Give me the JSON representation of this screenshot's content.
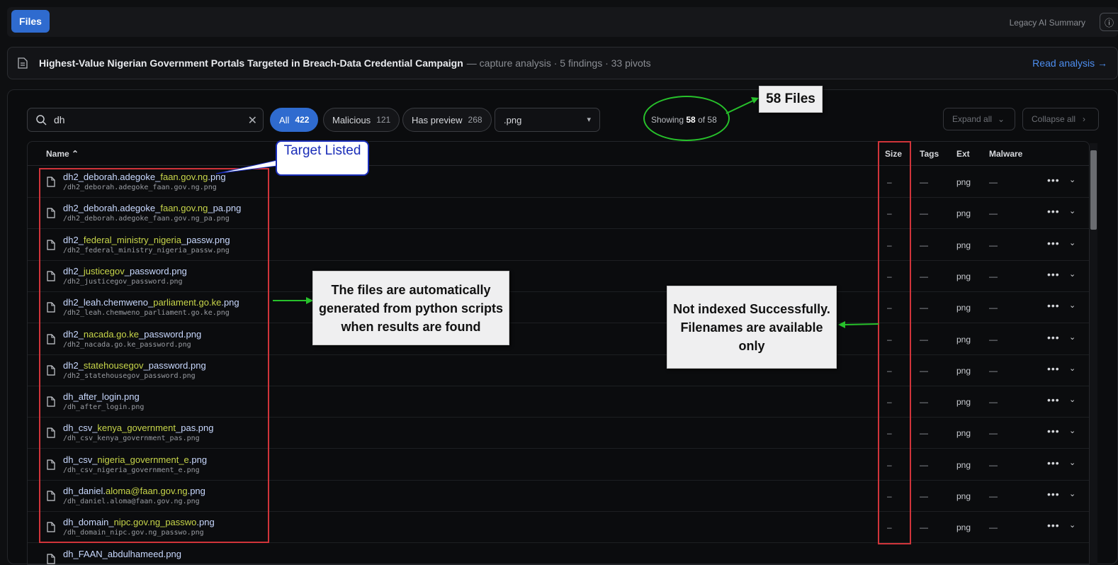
{
  "topbar": {
    "files_label": "Files",
    "legacy_label": "Legacy AI Summary",
    "info_icon": "info-icon"
  },
  "summary": {
    "title": "Highest-Value Nigerian Government Portals Targeted in Breach-Data Credential Campaign",
    "meta": "— capture analysis · 5 findings · 33 pivots",
    "read_label": "Read analysis →"
  },
  "toolbar": {
    "search_value": "dh",
    "chips": [
      {
        "label": "All",
        "count": "422"
      },
      {
        "label": "Malicious",
        "count": "121"
      },
      {
        "label": "Has preview",
        "count": "268"
      }
    ],
    "ext_value": ".png",
    "showing_prefix": "Showing",
    "showing_count": "58",
    "showing_suffix": "of 58",
    "expand_label": "Expand all",
    "collapse_label": "Collapse all"
  },
  "columns": {
    "name": "Name",
    "size": "Size",
    "tags": "Tags",
    "ext": "Ext",
    "malware": "Malware"
  },
  "rows": [
    {
      "name_parts": [
        "dh2_deborah.adegoke_",
        "faan.gov.ng",
        ".png"
      ],
      "path": "/dh2_deborah.adegoke_faan.gov.ng.png",
      "size": "–",
      "tags": "—",
      "ext": "png",
      "malware": "—"
    },
    {
      "name_parts": [
        "dh2_deborah.adegoke_",
        "faan.gov.ng",
        "_pa.png"
      ],
      "path": "/dh2_deborah.adegoke_faan.gov.ng_pa.png",
      "size": "–",
      "tags": "—",
      "ext": "png",
      "malware": "—"
    },
    {
      "name_parts": [
        "dh2_",
        "federal_ministry_nigeria",
        "_passw.png"
      ],
      "path": "/dh2_federal_ministry_nigeria_passw.png",
      "size": "–",
      "tags": "—",
      "ext": "png",
      "malware": "—"
    },
    {
      "name_parts": [
        "dh2_",
        "justicegov",
        "_password.png"
      ],
      "path": "/dh2_justicegov_password.png",
      "size": "–",
      "tags": "—",
      "ext": "png",
      "malware": "—"
    },
    {
      "name_parts": [
        "dh2_leah.chemweno_",
        "parliament.go.ke",
        ".png"
      ],
      "path": "/dh2_leah.chemweno_parliament.go.ke.png",
      "size": "–",
      "tags": "—",
      "ext": "png",
      "malware": "—"
    },
    {
      "name_parts": [
        "dh2_",
        "nacada.go.ke",
        "_password.png"
      ],
      "path": "/dh2_nacada.go.ke_password.png",
      "size": "–",
      "tags": "—",
      "ext": "png",
      "malware": "—"
    },
    {
      "name_parts": [
        "dh2_",
        "statehousegov",
        "_password.png"
      ],
      "path": "/dh2_statehousegov_password.png",
      "size": "–",
      "tags": "—",
      "ext": "png",
      "malware": "—"
    },
    {
      "name_parts": [
        "dh_after_login.png",
        "",
        ""
      ],
      "path": "/dh_after_login.png",
      "size": "–",
      "tags": "—",
      "ext": "png",
      "malware": "—"
    },
    {
      "name_parts": [
        "dh_csv_",
        "kenya_government",
        "_pas.png"
      ],
      "path": "/dh_csv_kenya_government_pas.png",
      "size": "–",
      "tags": "—",
      "ext": "png",
      "malware": "—"
    },
    {
      "name_parts": [
        "dh_csv_",
        "nigeria_government_e",
        ".png"
      ],
      "path": "/dh_csv_nigeria_government_e.png",
      "size": "–",
      "tags": "—",
      "ext": "png",
      "malware": "—"
    },
    {
      "name_parts": [
        "dh_daniel.",
        "aloma@faan.gov.ng",
        ".png"
      ],
      "path": "/dh_daniel.aloma@faan.gov.ng.png",
      "size": "–",
      "tags": "—",
      "ext": "png",
      "malware": "—"
    },
    {
      "name_parts": [
        "dh_domain_",
        "nipc.gov.ng_passwo",
        ".png"
      ],
      "path": "/dh_domain_nipc.gov.ng_passwo.png",
      "size": "–",
      "tags": "—",
      "ext": "png",
      "malware": "—"
    },
    {
      "name_parts": [
        "dh_FAAN_abdulhameed.png",
        "",
        ""
      ],
      "path": "",
      "size": "",
      "tags": "",
      "ext": "",
      "malware": ""
    }
  ],
  "annotations": {
    "target_listed": "Target Listed",
    "files_count": "58 Files",
    "auto_generated": "The files are automatically generated from python scripts when results are found",
    "not_indexed": "Not indexed Successfully. Filenames are available only"
  },
  "colors": {
    "accent": "#2f6bcf",
    "highlight": "#c8d64a",
    "annotation_red": "#d0343a",
    "annotation_green": "#27c12b"
  }
}
